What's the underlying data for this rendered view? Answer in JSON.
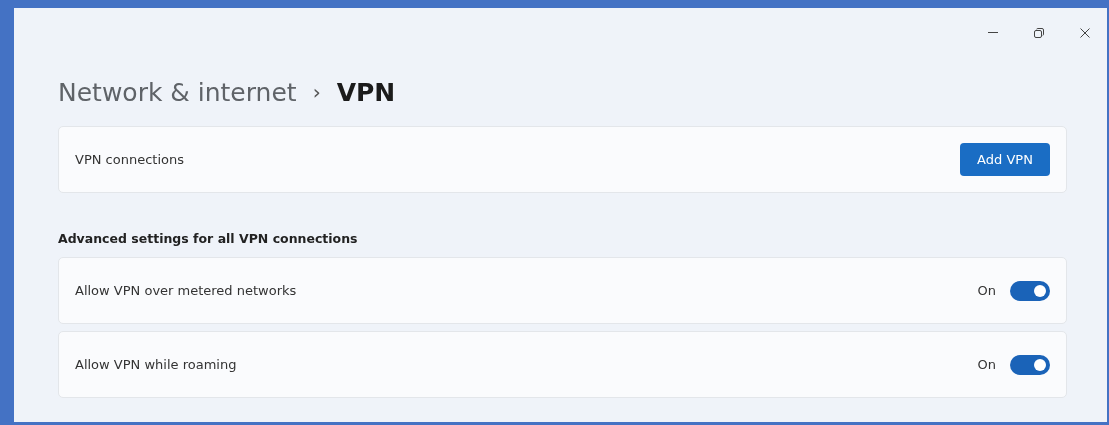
{
  "breadcrumb": {
    "parent": "Network & internet",
    "separator": "›",
    "current": "VPN"
  },
  "connections": {
    "label": "VPN connections",
    "button": "Add VPN"
  },
  "section_title": "Advanced settings for all VPN connections",
  "settings": [
    {
      "label": "Allow VPN over metered networks",
      "state_text": "On",
      "on": true
    },
    {
      "label": "Allow VPN while roaming",
      "state_text": "On",
      "on": true
    }
  ]
}
